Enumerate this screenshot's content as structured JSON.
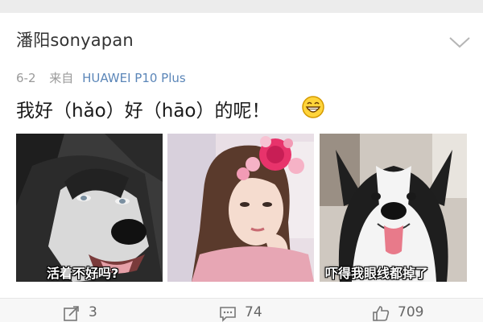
{
  "post": {
    "username": "潘阳sonyapan",
    "date": "6-2",
    "source_label": "来自",
    "device": "HUAWEI P10 Plus",
    "text": "我好（hǎo）好（hāo）的呢！"
  },
  "icons": {
    "expand": "chevron-down-icon",
    "emoji": "grin-emoji-icon",
    "repost": "repost-icon",
    "comment": "comment-icon",
    "like": "thumbs-up-icon"
  },
  "images": [
    {
      "subject": "husky-side-eye",
      "caption": "活着不好吗?"
    },
    {
      "subject": "girl-flower-crown",
      "caption": ""
    },
    {
      "subject": "smiling-husky",
      "caption": "吓得我眼线都掉了"
    }
  ],
  "actions": {
    "repost_count": "3",
    "comment_count": "74",
    "like_count": "709"
  },
  "colors": {
    "background": "#ececec",
    "card": "#ffffff",
    "link": "#5b86b8",
    "meta": "#9a9a9a"
  }
}
